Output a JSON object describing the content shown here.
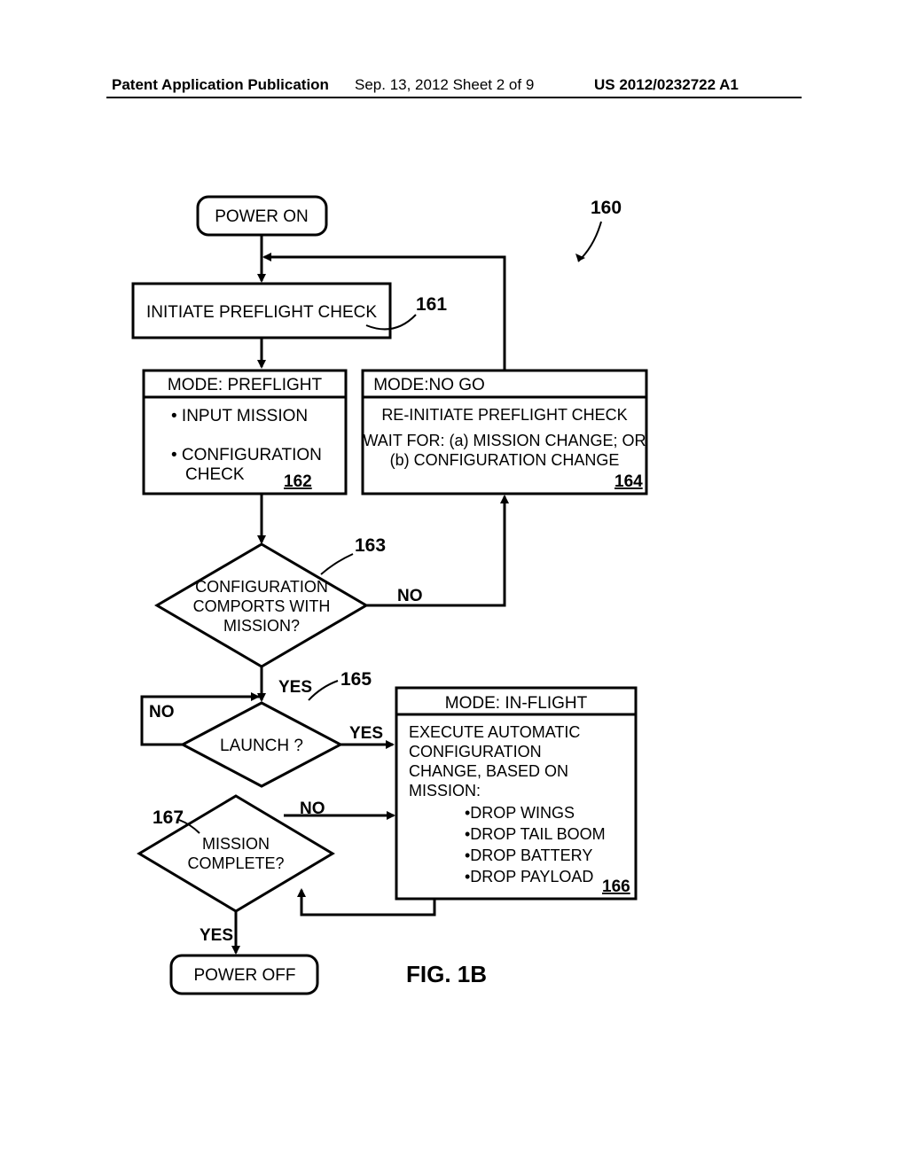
{
  "header": {
    "left": "Patent Application Publication",
    "center": "Sep. 13, 2012  Sheet 2 of 9",
    "right": "US 2012/0232722 A1"
  },
  "labels": {
    "ref160": "160",
    "ref161": "161",
    "ref162": "162",
    "ref163": "163",
    "ref164": "164",
    "ref165": "165",
    "ref166": "166",
    "ref167": "167"
  },
  "boxes": {
    "power_on": "POWER ON",
    "initiate": "INITIATE PREFLIGHT CHECK",
    "preflight_title": "MODE: PREFLIGHT",
    "preflight_l1": "• INPUT MISSION",
    "preflight_l2": "• CONFIGURATION",
    "preflight_l3": "CHECK",
    "nogo_title": "MODE:NO GO",
    "nogo_l1": "RE-INITIATE PREFLIGHT CHECK",
    "nogo_l2": "WAIT FOR: (a) MISSION CHANGE; OR",
    "nogo_l3": "(b) CONFIGURATION CHANGE",
    "cfg_l1": "CONFIGURATION",
    "cfg_l2": "COMPORTS WITH",
    "cfg_l3": "MISSION?",
    "launch": "LAUNCH ?",
    "mission_l1": "MISSION",
    "mission_l2": "COMPLETE?",
    "inflight_title": "MODE: IN-FLIGHT",
    "inflight_l1": "EXECUTE AUTOMATIC",
    "inflight_l2": "CONFIGURATION",
    "inflight_l3": "CHANGE, BASED ON",
    "inflight_l4": "MISSION:",
    "inflight_b1": "•DROP WINGS",
    "inflight_b2": "•DROP TAIL BOOM",
    "inflight_b3": "•DROP BATTERY",
    "inflight_b4": "•DROP PAYLOAD",
    "power_off": "POWER OFF"
  },
  "edges": {
    "yes": "YES",
    "no": "NO"
  },
  "figure": "FIG. 1B"
}
